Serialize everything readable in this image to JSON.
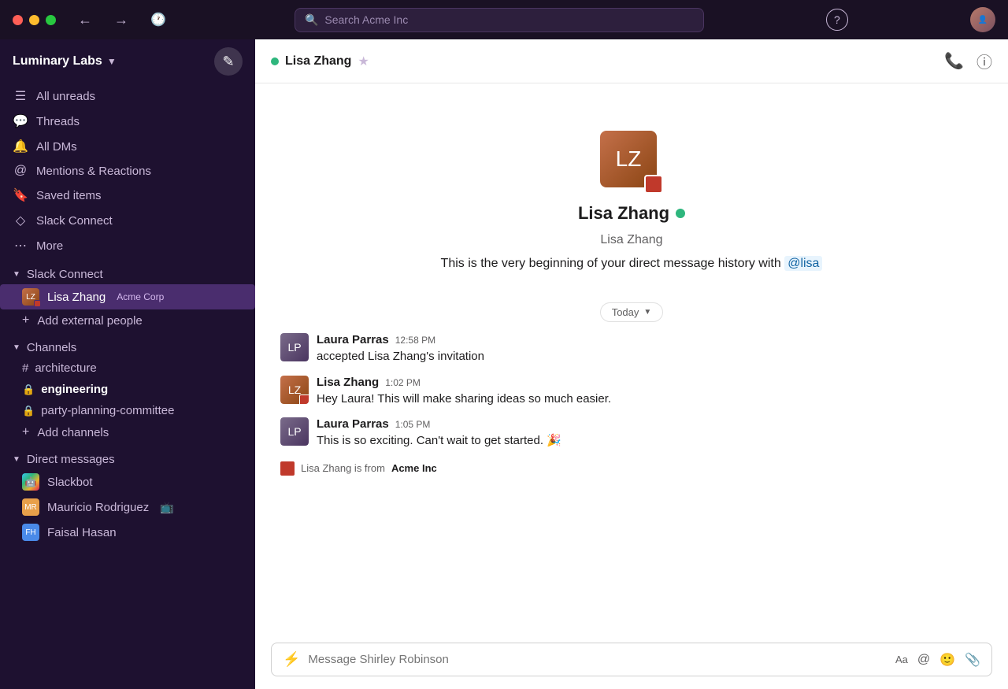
{
  "titlebar": {
    "search_placeholder": "Search Acme Inc"
  },
  "sidebar": {
    "workspace_name": "Luminary Labs",
    "nav_items": [
      {
        "id": "all-unreads",
        "label": "All unreads",
        "icon": "☰"
      },
      {
        "id": "threads",
        "label": "Threads",
        "icon": "💬"
      },
      {
        "id": "all-dms",
        "label": "All DMs",
        "icon": "🔔"
      },
      {
        "id": "mentions-reactions",
        "label": "Mentions & Reactions",
        "icon": "🔔"
      },
      {
        "id": "saved-items",
        "label": "Saved items",
        "icon": "🔖"
      },
      {
        "id": "slack-connect",
        "label": "Slack Connect",
        "icon": "◇"
      },
      {
        "id": "more",
        "label": "More",
        "icon": "⋯"
      }
    ],
    "slack_connect_section": "Slack Connect",
    "slack_connect_items": [
      {
        "id": "lisa-zhang",
        "name": "Lisa Zhang",
        "company": "Acme Corp",
        "active": true
      }
    ],
    "add_external_label": "Add external people",
    "channels_section": "Channels",
    "channels": [
      {
        "id": "architecture",
        "name": "architecture",
        "type": "hash"
      },
      {
        "id": "engineering",
        "name": "engineering",
        "type": "lock",
        "bold": true
      },
      {
        "id": "party-planning",
        "name": "party-planning-committee",
        "type": "lock"
      }
    ],
    "add_channels_label": "Add channels",
    "direct_messages_section": "Direct messages",
    "direct_messages": [
      {
        "id": "slackbot",
        "name": "Slackbot",
        "type": "bot"
      },
      {
        "id": "mauricio",
        "name": "Mauricio Rodriguez",
        "type": "user",
        "has_icon": true
      },
      {
        "id": "faisal",
        "name": "Faisal Hasan",
        "type": "user"
      }
    ]
  },
  "chat": {
    "contact_name": "Lisa Zhang",
    "contact_username": "Lisa Zhang",
    "dm_history_text": "This is the very beginning of your direct message history with",
    "dm_mention": "@lisa",
    "today_label": "Today",
    "messages": [
      {
        "id": "msg1",
        "sender": "Laura Parras",
        "time": "12:58 PM",
        "text": "accepted Lisa Zhang's invitation",
        "type": "system"
      },
      {
        "id": "msg2",
        "sender": "Lisa Zhang",
        "time": "1:02 PM",
        "text": "Hey Laura! This will make sharing ideas so much easier."
      },
      {
        "id": "msg3",
        "sender": "Laura Parras",
        "time": "1:05 PM",
        "text": "This is so exciting. Can't wait to get started. 🎉"
      }
    ],
    "company_notice": "Lisa Zhang is from",
    "company_name": "Acme Inc",
    "input_placeholder": "Message Shirley Robinson"
  }
}
